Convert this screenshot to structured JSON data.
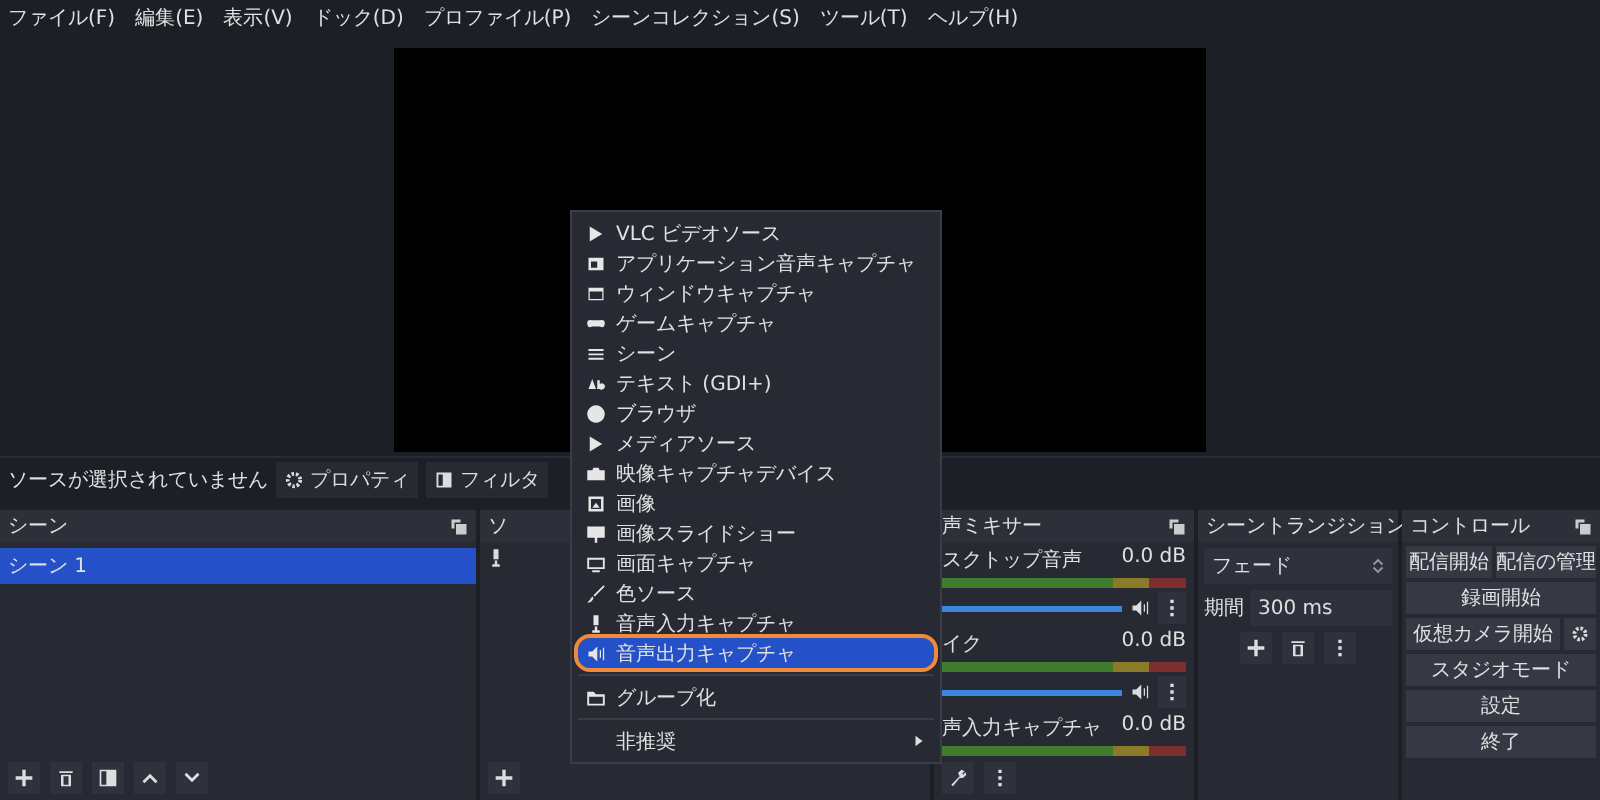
{
  "menubar": [
    "ファイル(F)",
    "編集(E)",
    "表示(V)",
    "ドック(D)",
    "プロファイル(P)",
    "シーンコレクション(S)",
    "ツール(T)",
    "ヘルプ(H)"
  ],
  "source_bar": {
    "status": "ソースが選択されていません",
    "buttons": [
      {
        "label": "プロパティ"
      },
      {
        "label": "フィルタ"
      }
    ]
  },
  "scenes": {
    "title": "シーン",
    "items": [
      {
        "label": "シーン 1",
        "selected": true
      }
    ]
  },
  "sources": {
    "title": "ソ"
  },
  "context_menu": {
    "sections": [
      [
        {
          "label": "VLC ビデオソース",
          "selected": false,
          "submenu": false
        },
        {
          "label": "アプリケーション音声キャプチャ",
          "selected": false,
          "submenu": false
        },
        {
          "label": "ウィンドウキャプチャ",
          "selected": false,
          "submenu": false
        },
        {
          "label": "ゲームキャプチャ",
          "selected": false,
          "submenu": false
        },
        {
          "label": "シーン",
          "selected": false,
          "submenu": false
        },
        {
          "label": "テキスト (GDI+)",
          "selected": false,
          "submenu": false
        },
        {
          "label": "ブラウザ",
          "selected": false,
          "submenu": false
        },
        {
          "label": "メディアソース",
          "selected": false,
          "submenu": false
        },
        {
          "label": "映像キャプチャデバイス",
          "selected": false,
          "submenu": false
        },
        {
          "label": "画像",
          "selected": false,
          "submenu": false
        },
        {
          "label": "画像スライドショー",
          "selected": false,
          "submenu": false
        },
        {
          "label": "画面キャプチャ",
          "selected": false,
          "submenu": false
        },
        {
          "label": "色ソース",
          "selected": false,
          "submenu": false
        },
        {
          "label": "音声入力キャプチャ",
          "selected": false,
          "submenu": false
        },
        {
          "label": "音声出力キャプチャ",
          "selected": true,
          "submenu": false
        }
      ],
      [
        {
          "label": "グループ化",
          "selected": false,
          "submenu": false
        }
      ],
      [
        {
          "label": "非推奨",
          "selected": false,
          "submenu": true
        }
      ]
    ]
  },
  "mixer": {
    "title": "声ミキサー",
    "channels": [
      {
        "name": "スクトップ音声",
        "reading": "0.0 dB",
        "level": 1
      },
      {
        "name": "イク",
        "reading": "0.0 dB",
        "level": 1
      },
      {
        "name": "声入力キャプチャ",
        "reading": "0.0 dB"
      }
    ]
  },
  "transitions": {
    "title": "シーントランジション",
    "select": "フェード",
    "duration_label": "期間",
    "duration": "300 ms"
  },
  "controls": {
    "title": "コントロール",
    "rows": [
      {
        "buttons": [
          "配信開始",
          "配信の管理"
        ],
        "settings": false
      },
      {
        "buttons": [
          "録画開始"
        ],
        "settings": false
      },
      {
        "buttons": [
          "仮想カメラ開始"
        ],
        "settings": true
      },
      {
        "buttons": [
          "スタジオモード"
        ],
        "settings": false
      },
      {
        "buttons": [
          "設定"
        ],
        "settings": false
      },
      {
        "buttons": [
          "終了"
        ],
        "settings": false
      }
    ]
  }
}
